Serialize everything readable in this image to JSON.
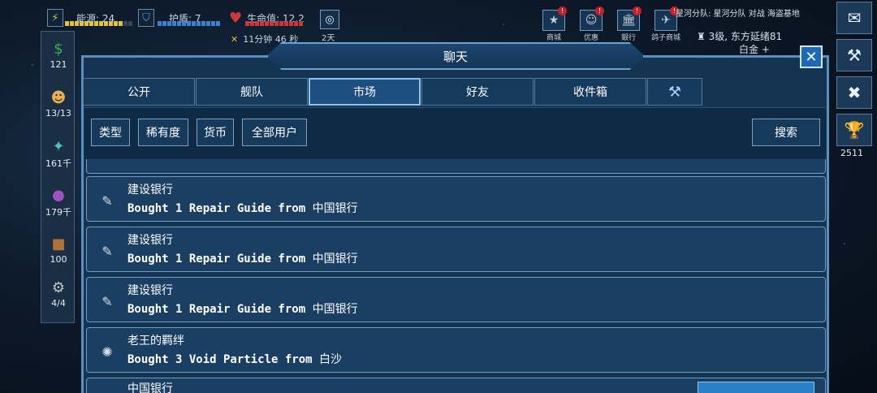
{
  "hud": {
    "energy_label": "能源: 24",
    "shield_label": "护盾: 7",
    "hp_label": "生命值: 12.2",
    "timer": "11分钟 46 秒",
    "days": "2天",
    "colors": {
      "energy": "#e0c24a",
      "shield": "#3f7fd0",
      "hp": "#c83a3a"
    }
  },
  "top_icons": [
    {
      "label": "商城",
      "icon": "star-shop-icon",
      "glyph": "★",
      "alert": "!"
    },
    {
      "label": "优惠",
      "icon": "discount-icon",
      "glyph": "☺",
      "alert": "!"
    },
    {
      "label": "銀行",
      "icon": "bank-icon",
      "glyph": "🏛",
      "alert": "!"
    },
    {
      "label": "鸽子商城",
      "icon": "pigeon-shop-icon",
      "glyph": "✈",
      "alert": "!"
    }
  ],
  "fleet": {
    "line1": "星河分队: 星河分队 对战 海盗基地",
    "line2": "3级, 东方延绪81",
    "line3": "白金 +"
  },
  "sidebar": [
    {
      "value": "121",
      "icon": "money-icon",
      "glyph": "$"
    },
    {
      "value": "13/13",
      "icon": "crew-icon",
      "glyph": "☻"
    },
    {
      "value": "161千",
      "icon": "crystal-icon",
      "glyph": "✦"
    },
    {
      "value": "179千",
      "icon": "orb-icon",
      "glyph": "●"
    },
    {
      "value": "100",
      "icon": "cargo-icon",
      "glyph": "■"
    },
    {
      "value": "4/4",
      "icon": "drone-icon",
      "glyph": "⚙"
    }
  ],
  "right_column": [
    {
      "icon": "chat-icon",
      "glyph": "✉"
    },
    {
      "icon": "hammer-icon",
      "glyph": "⚒"
    },
    {
      "icon": "no-weapon-icon",
      "glyph": "✖"
    },
    {
      "icon": "trophy-icon",
      "glyph": "🏆",
      "value": "2511"
    }
  ],
  "chat": {
    "title": "聊天",
    "tabs": [
      {
        "label": "公开",
        "active": false
      },
      {
        "label": "舰队",
        "active": false
      },
      {
        "label": "市场",
        "active": true
      },
      {
        "label": "好友",
        "active": false
      },
      {
        "label": "收件箱",
        "active": false
      },
      {
        "label": "",
        "icon": "hammer-icon",
        "glyph": "⚒",
        "active": false
      }
    ],
    "filters": [
      "类型",
      "稀有度",
      "货币",
      "全部用户"
    ],
    "search_label": "搜索",
    "messages": [
      {
        "name": "建设银行",
        "action": "Bought 1 Repair Guide from",
        "seller": "中国银行",
        "icon": "repair-guide-icon",
        "glyph": "✎"
      },
      {
        "name": "建设银行",
        "action": "Bought 1 Repair Guide from",
        "seller": "中国银行",
        "icon": "repair-guide-icon",
        "glyph": "✎"
      },
      {
        "name": "建设银行",
        "action": "Bought 1 Repair Guide from",
        "seller": "中国银行",
        "icon": "repair-guide-icon",
        "glyph": "✎"
      },
      {
        "name": "老王的羁绊",
        "action": "Bought 3 Void Particle from",
        "seller": "白沙",
        "icon": "void-particle-icon",
        "glyph": "✺"
      }
    ],
    "partial_bottom_name": "中国银行"
  }
}
